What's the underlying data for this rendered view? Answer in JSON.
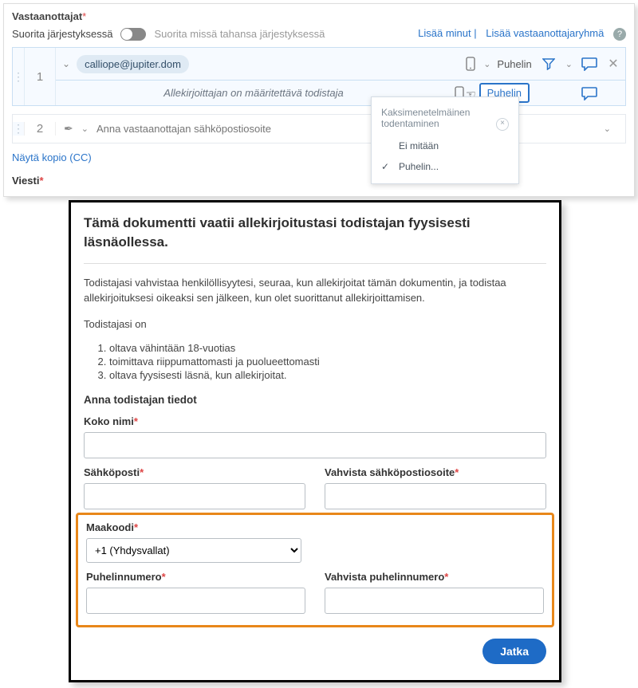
{
  "header": {
    "recipients_label": "Vastaanottajat",
    "order_label": "Suorita järjestyksessä",
    "any_order_label": "Suorita missä tahansa järjestyksessä",
    "add_me": "Lisää minut",
    "add_group": "Lisää vastaanottajaryhmä"
  },
  "rows": [
    {
      "num": "1",
      "email": "calliope@jupiter.dom",
      "phone_label": "Puhelin",
      "witness_note": "Allekirjoittajan on määritettävä todistaja",
      "phone_btn": "Puhelin"
    },
    {
      "num": "2",
      "placeholder": "Anna vastaanottajan sähköpostiosoite"
    }
  ],
  "dropdown": {
    "title": "Kaksimenetelmäinen todentaminen",
    "none": "Ei mitään",
    "phone": "Puhelin..."
  },
  "cc_label": "Näytä kopio (CC)",
  "viesti": "Viesti",
  "modal": {
    "title": "Tämä dokumentti vaatii allekirjoitustasi todistajan fyysisesti läsnäollessa.",
    "p1": "Todistajasi vahvistaa henkilöllisyytesi, seuraa, kun allekirjoitat tämän dokumentin, ja todistaa allekirjoituksesi oikeaksi sen jälkeen, kun olet suorittanut allekirjoittamisen.",
    "p2": "Todistajasi on",
    "li1": "oltava vähintään 18-vuotias",
    "li2": "toimittava riippumattomasti ja puolueettomasti",
    "li3": "oltava fyysisesti läsnä, kun allekirjoitat.",
    "section": "Anna todistajan tiedot",
    "fullname": "Koko nimi",
    "email": "Sähköposti",
    "email_confirm": "Vahvista sähköpostiosoite",
    "country": "Maakoodi",
    "country_val": "+1 (Yhdysvallat)",
    "phone": "Puhelinnumero",
    "phone_confirm": "Vahvista puhelinnumero",
    "continue": "Jatka"
  }
}
